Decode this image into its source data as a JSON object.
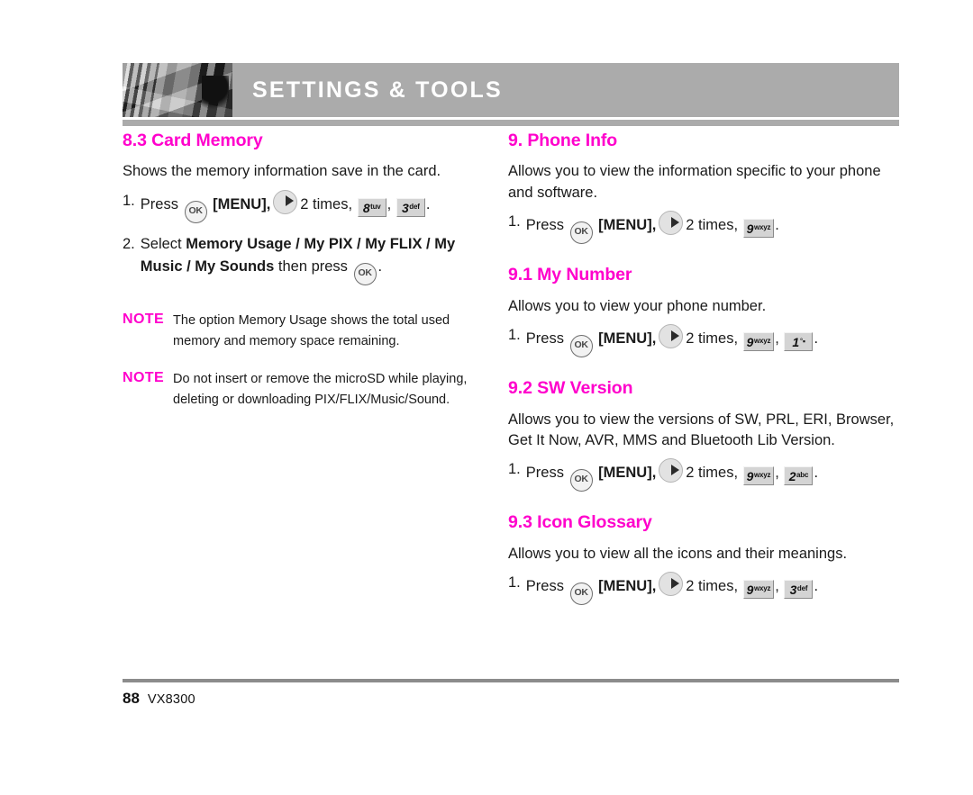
{
  "header": {
    "title": "SETTINGS & TOOLS",
    "photo_alt": "grayscale-photo-poles"
  },
  "icons": {
    "ok": "OK",
    "nav_right": "nav-right-icon"
  },
  "left_column": {
    "section": {
      "heading": "8.3 Card Memory",
      "intro": "Shows the memory information save in the card.",
      "steps": [
        {
          "num": "1.",
          "press_label": "Press",
          "menu_label": "[MENU],",
          "times_label": "2 times,",
          "keys": [
            {
              "digit": "8",
              "sub": "tuv"
            },
            {
              "digit": "3",
              "sub": "def"
            }
          ],
          "trailing": "."
        },
        {
          "num": "2.",
          "select_label": "Select",
          "options_line1": "Memory Usage / My PIX / My FLIX / My",
          "options_line2": "Music / My Sounds",
          "then_press": "then press",
          "trailing": "."
        }
      ]
    },
    "notes": [
      {
        "label": "NOTE",
        "text": "The option Memory Usage shows the total used memory and memory space remaining."
      },
      {
        "label": "NOTE",
        "text": "Do not insert or remove the microSD while playing, deleting or downloading PIX/FLIX/Music/Sound."
      }
    ]
  },
  "right_column": {
    "sections": [
      {
        "heading": "9. Phone Info",
        "body": "Allows you to view the information specific to your phone and software.",
        "step": {
          "num": "1.",
          "press_label": "Press",
          "menu_label": "[MENU],",
          "times_label": "2 times,",
          "keys": [
            {
              "digit": "9",
              "sub": "wxyz"
            }
          ],
          "trailing": "."
        }
      },
      {
        "heading": "9.1 My Number",
        "body": "Allows you to view your phone number.",
        "step": {
          "num": "1.",
          "press_label": "Press",
          "menu_label": "[MENU],",
          "times_label": "2 times,",
          "keys": [
            {
              "digit": "9",
              "sub": "wxyz"
            },
            {
              "digit": "1",
              "sym": "°▪"
            }
          ],
          "trailing": "."
        }
      },
      {
        "heading": "9.2 SW Version",
        "body": "Allows you to view the versions of SW, PRL, ERI, Browser, Get It Now, AVR, MMS and Bluetooth Lib Version.",
        "step": {
          "num": "1.",
          "press_label": "Press",
          "menu_label": "[MENU],",
          "times_label": "2 times,",
          "keys": [
            {
              "digit": "9",
              "sub": "wxyz"
            },
            {
              "digit": "2",
              "sub": "abc"
            }
          ],
          "trailing": "."
        }
      },
      {
        "heading": "9.3 Icon Glossary",
        "body": "Allows you to view all the icons and their meanings.",
        "step": {
          "num": "1.",
          "press_label": "Press",
          "menu_label": "[MENU],",
          "times_label": "2 times,",
          "keys": [
            {
              "digit": "9",
              "sub": "wxyz"
            },
            {
              "digit": "3",
              "sub": "def"
            }
          ],
          "trailing": "."
        }
      }
    ]
  },
  "footer": {
    "page_number": "88",
    "model": "VX8300"
  },
  "colors": {
    "accent": "#ff00cc",
    "header_gray": "#ababab",
    "rule_gray": "#8c8c8c"
  }
}
